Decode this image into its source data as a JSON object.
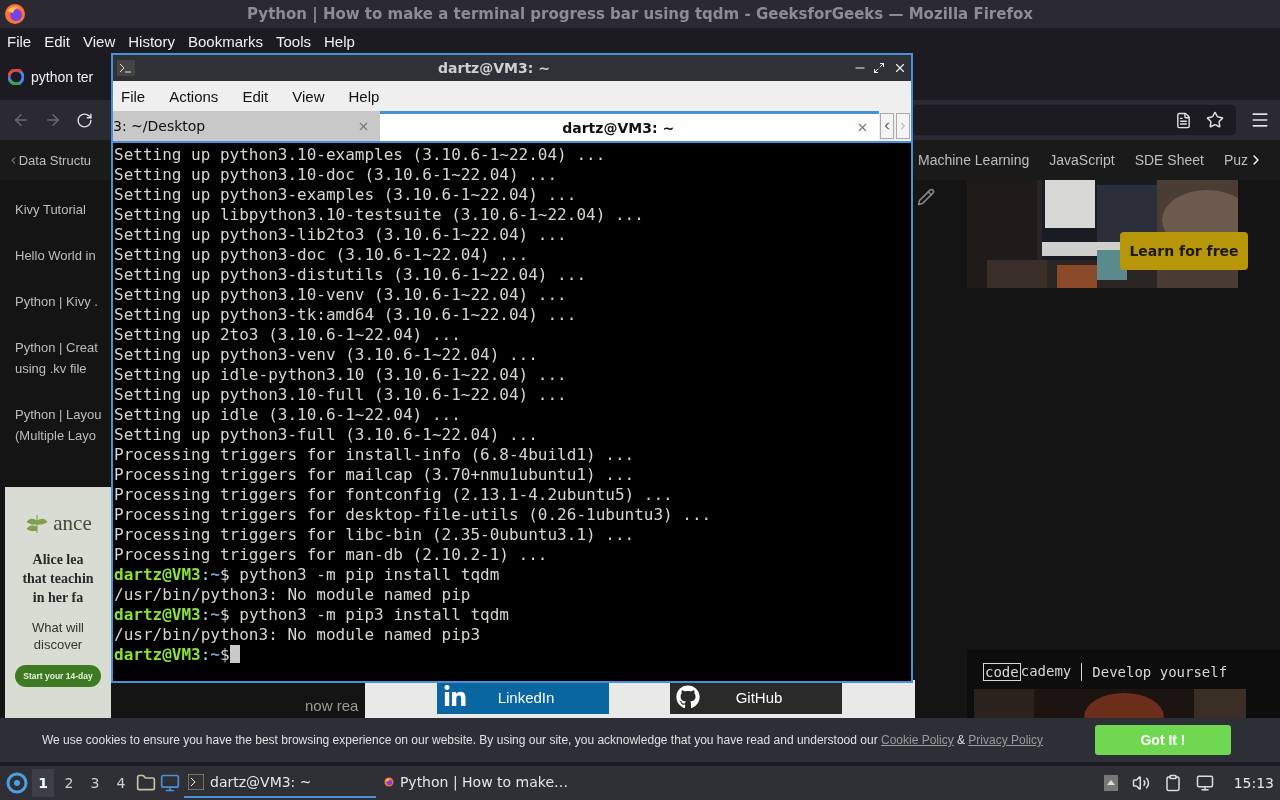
{
  "browser": {
    "title": "Python | How to make a terminal progress bar using tqdm - GeeksforGeeks — Mozilla Firefox",
    "menu": [
      "File",
      "Edit",
      "View",
      "History",
      "Bookmarks",
      "Tools",
      "Help"
    ],
    "tab": {
      "title": "python ter"
    },
    "topics": [
      "Data Structu",
      "Machine Learning",
      "JavaScript",
      "SDE Sheet",
      "Puz"
    ],
    "sidebar": [
      {
        "lines": [
          "Kivy Tutorial"
        ]
      },
      {
        "lines": [
          "Hello World in"
        ]
      },
      {
        "lines": [
          "Python | Kivy ."
        ]
      },
      {
        "lines": [
          "Python | Creat",
          "using .kv file"
        ]
      },
      {
        "lines": [
          "Python | Layou",
          "(Multiple Layo"
        ]
      }
    ],
    "left_ad": {
      "brand": "ance",
      "headline": [
        "Alice lea",
        "that teachin",
        "in her fa"
      ],
      "body": [
        "What will",
        "discover"
      ],
      "button": "Start your 14-day"
    },
    "article": {
      "text": "now rea"
    },
    "share": [
      "LinkedIn",
      "GitHub"
    ],
    "promo": {
      "button": "Learn for free"
    },
    "codecademy": {
      "logo_boxed": "code",
      "logo_rest": "cademy",
      "tagline": "Develop yourself"
    },
    "cookie": {
      "text": "We use cookies to ensure you have the best browsing experience on our website. By using our site, you acknowledge that you have read and understood our ",
      "link_1": "Cookie Policy",
      "joiner": " & ",
      "link_2": "Privacy Policy",
      "button": "Got It !"
    }
  },
  "terminal": {
    "title": "dartz@VM3: ~",
    "menu": [
      "File",
      "Actions",
      "Edit",
      "View",
      "Help"
    ],
    "tabs": [
      {
        "label": "3: ~/Desktop",
        "selected": false
      },
      {
        "label": "dartz@VM3: ~",
        "selected": true
      }
    ],
    "lines": [
      {
        "kind": "output",
        "text": "Setting up python3.10-examples (3.10.6-1~22.04) ..."
      },
      {
        "kind": "output",
        "text": "Setting up python3.10-doc (3.10.6-1~22.04) ..."
      },
      {
        "kind": "output",
        "text": "Setting up python3-examples (3.10.6-1~22.04) ..."
      },
      {
        "kind": "output",
        "text": "Setting up libpython3.10-testsuite (3.10.6-1~22.04) ..."
      },
      {
        "kind": "output",
        "text": "Setting up python3-lib2to3 (3.10.6-1~22.04) ..."
      },
      {
        "kind": "output",
        "text": "Setting up python3-doc (3.10.6-1~22.04) ..."
      },
      {
        "kind": "output",
        "text": "Setting up python3-distutils (3.10.6-1~22.04) ..."
      },
      {
        "kind": "output",
        "text": "Setting up python3.10-venv (3.10.6-1~22.04) ..."
      },
      {
        "kind": "output",
        "text": "Setting up python3-tk:amd64 (3.10.6-1~22.04) ..."
      },
      {
        "kind": "output",
        "text": "Setting up 2to3 (3.10.6-1~22.04) ..."
      },
      {
        "kind": "output",
        "text": "Setting up python3-venv (3.10.6-1~22.04) ..."
      },
      {
        "kind": "output",
        "text": "Setting up idle-python3.10 (3.10.6-1~22.04) ..."
      },
      {
        "kind": "output",
        "text": "Setting up python3.10-full (3.10.6-1~22.04) ..."
      },
      {
        "kind": "output",
        "text": "Setting up idle (3.10.6-1~22.04) ..."
      },
      {
        "kind": "output",
        "text": "Setting up python3-full (3.10.6-1~22.04) ..."
      },
      {
        "kind": "output",
        "text": "Processing triggers for install-info (6.8-4build1) ..."
      },
      {
        "kind": "output",
        "text": "Processing triggers for mailcap (3.70+nmu1ubuntu1) ..."
      },
      {
        "kind": "output",
        "text": "Processing triggers for fontconfig (2.13.1-4.2ubuntu5) ..."
      },
      {
        "kind": "output",
        "text": "Processing triggers for desktop-file-utils (0.26-1ubuntu3) ..."
      },
      {
        "kind": "output",
        "text": "Processing triggers for libc-bin (2.35-0ubuntu3.1) ..."
      },
      {
        "kind": "output",
        "text": "Processing triggers for man-db (2.10.2-1) ..."
      },
      {
        "kind": "prompt",
        "user": "dartz@VM3",
        "sep": ":",
        "path": "~",
        "sign": "$",
        "command": " python3 -m pip install tqdm"
      },
      {
        "kind": "output",
        "text": "/usr/bin/python3: No module named pip"
      },
      {
        "kind": "prompt",
        "user": "dartz@VM3",
        "sep": ":",
        "path": "~",
        "sign": "$",
        "command": " python3 -m pip3 install tqdm"
      },
      {
        "kind": "output",
        "text": "/usr/bin/python3: No module named pip3"
      },
      {
        "kind": "prompt",
        "user": "dartz@VM3",
        "sep": ":",
        "path": "~",
        "sign": "$",
        "cursor": true
      }
    ]
  },
  "taskbar": {
    "workspaces": [
      {
        "label": "1",
        "selected": true
      },
      {
        "label": "2",
        "selected": false
      },
      {
        "label": "3",
        "selected": false
      },
      {
        "label": "4",
        "selected": false
      }
    ],
    "tasks": [
      {
        "kind": "terminal",
        "title": "dartz@VM3: ~",
        "selected": true
      },
      {
        "kind": "browser",
        "title": "Python | How to make…",
        "selected": false
      }
    ],
    "clock": "15:13"
  }
}
